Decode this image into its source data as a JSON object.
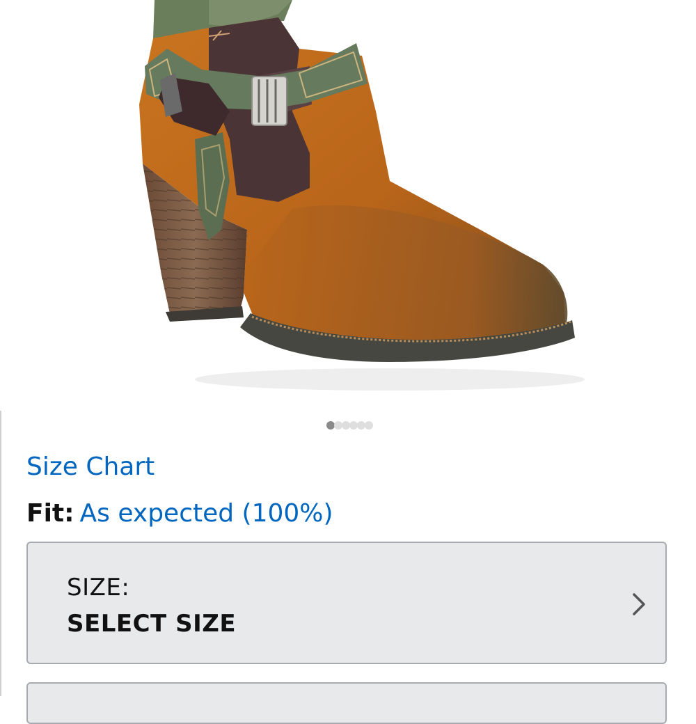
{
  "product": {
    "image_alt": "brown leather heeled ankle boot with green embossed strap and buckle",
    "carousel": {
      "total": 6,
      "active": 1
    }
  },
  "links": {
    "size_chart": "Size Chart"
  },
  "fit": {
    "label": "Fit:",
    "value": "As expected (100%)"
  },
  "size_selector": {
    "label": "SIZE:",
    "value": "SELECT SIZE",
    "icon": "chevron-right-icon"
  },
  "colors": {
    "link": "#0066c0",
    "selector_bg": "#e8e9eb",
    "selector_border": "#a7aaaf",
    "text": "#111111"
  }
}
